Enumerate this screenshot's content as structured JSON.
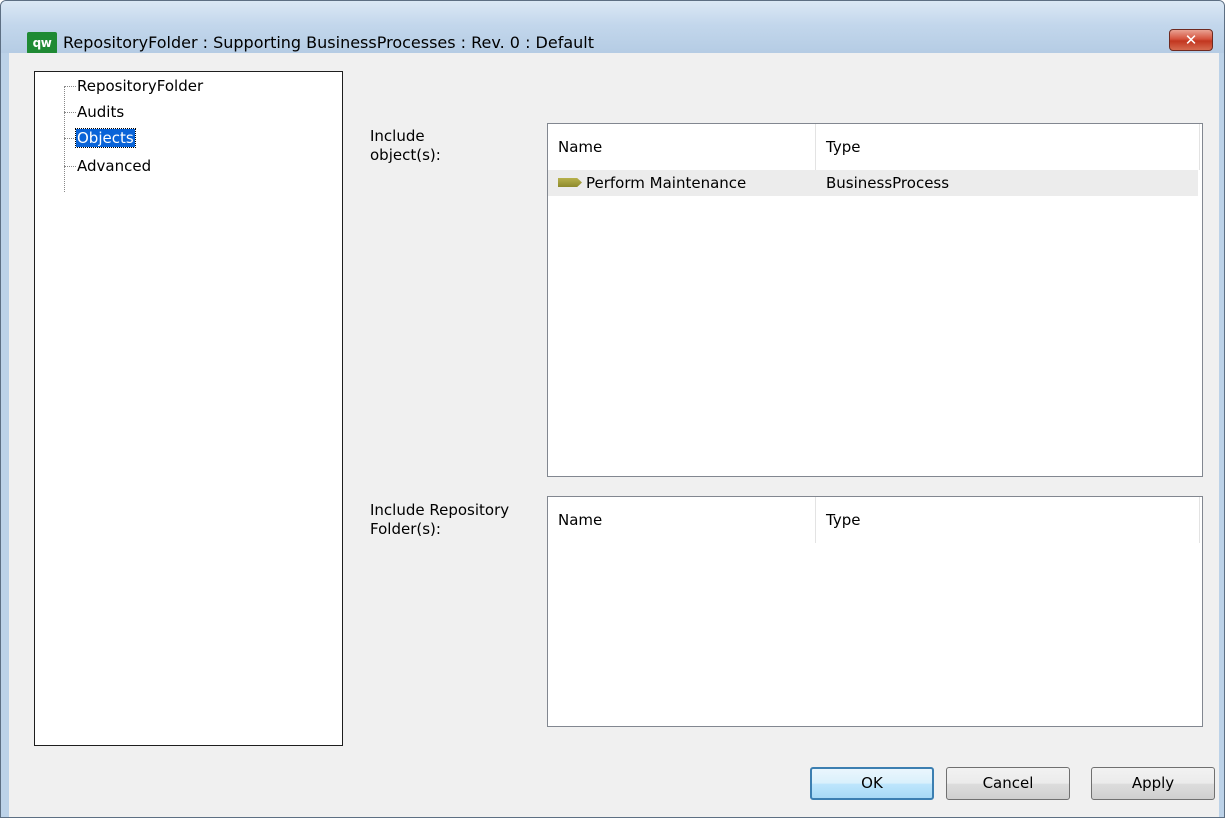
{
  "window": {
    "title": "RepositoryFolder : Supporting BusinessProcesses : Rev. 0  : Default",
    "app_icon_text": "qw",
    "close_glyph": "✕"
  },
  "tree": {
    "items": [
      {
        "label": "RepositoryFolder",
        "selected": false
      },
      {
        "label": "Audits",
        "selected": false
      },
      {
        "label": "Objects",
        "selected": true
      },
      {
        "label": "Advanced",
        "selected": false
      }
    ]
  },
  "objects_section": {
    "label": "Include object(s):",
    "columns": [
      "Name",
      "Type"
    ],
    "rows": [
      {
        "icon": "business-process-icon",
        "name": "Perform Maintenance",
        "type": "BusinessProcess"
      }
    ]
  },
  "folders_section": {
    "label": "Include Repository Folder(s):",
    "columns": [
      "Name",
      "Type"
    ],
    "rows": []
  },
  "buttons": {
    "ok": "OK",
    "cancel": "Cancel",
    "apply": "Apply"
  },
  "colors": {
    "selection": "#0a64d8",
    "app_icon": "#1f8a34",
    "close_button": "#c2361f"
  }
}
